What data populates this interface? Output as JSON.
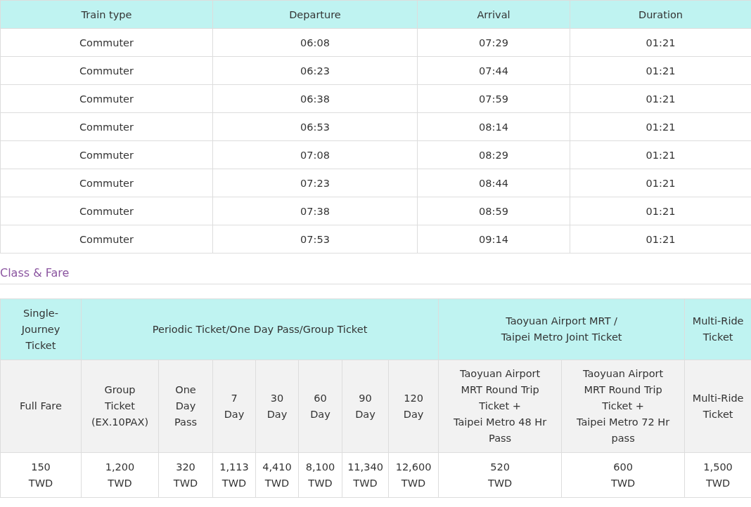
{
  "schedule": {
    "columns": [
      "Train type",
      "Departure",
      "Arrival",
      "Duration"
    ],
    "rows": [
      [
        "Commuter",
        "06:08",
        "07:29",
        "01:21"
      ],
      [
        "Commuter",
        "06:23",
        "07:44",
        "01:21"
      ],
      [
        "Commuter",
        "06:38",
        "07:59",
        "01:21"
      ],
      [
        "Commuter",
        "06:53",
        "08:14",
        "01:21"
      ],
      [
        "Commuter",
        "07:08",
        "08:29",
        "01:21"
      ],
      [
        "Commuter",
        "07:23",
        "08:44",
        "01:21"
      ],
      [
        "Commuter",
        "07:38",
        "08:59",
        "01:21"
      ],
      [
        "Commuter",
        "07:53",
        "09:14",
        "01:21"
      ]
    ]
  },
  "section_title": "Class & Fare",
  "fare": {
    "groups": [
      {
        "label": "Single-\nJourney\nTicket",
        "columns": [
          {
            "label": "Full Fare",
            "price": "150\nTWD"
          }
        ]
      },
      {
        "label": "Periodic Ticket/One Day Pass/Group Ticket",
        "columns": [
          {
            "label": "Group\nTicket\n(EX.10PAX)",
            "price": "1,200\nTWD"
          },
          {
            "label": "One\nDay\nPass",
            "price": "320\nTWD"
          },
          {
            "label": "7\nDay",
            "price": "1,113\nTWD"
          },
          {
            "label": "30\nDay",
            "price": "4,410\nTWD"
          },
          {
            "label": "60\nDay",
            "price": "8,100\nTWD"
          },
          {
            "label": "90\nDay",
            "price": "11,340\nTWD"
          },
          {
            "label": "120\nDay",
            "price": "12,600\nTWD"
          }
        ]
      },
      {
        "label": "Taoyuan Airport MRT /\nTaipei Metro  Joint Ticket",
        "columns": [
          {
            "label": "Taoyuan Airport\nMRT Round Trip\nTicket +\nTaipei Metro 48 Hr\nPass",
            "price": "520\nTWD"
          },
          {
            "label": "Taoyuan Airport\nMRT Round Trip\nTicket +\nTaipei Metro 72 Hr\npass",
            "price": "600\nTWD"
          }
        ]
      },
      {
        "label": "Multi-Ride\nTicket",
        "columns": [
          {
            "label": "Multi-Ride\nTicket",
            "price": "1,500\nTWD"
          }
        ]
      }
    ]
  }
}
